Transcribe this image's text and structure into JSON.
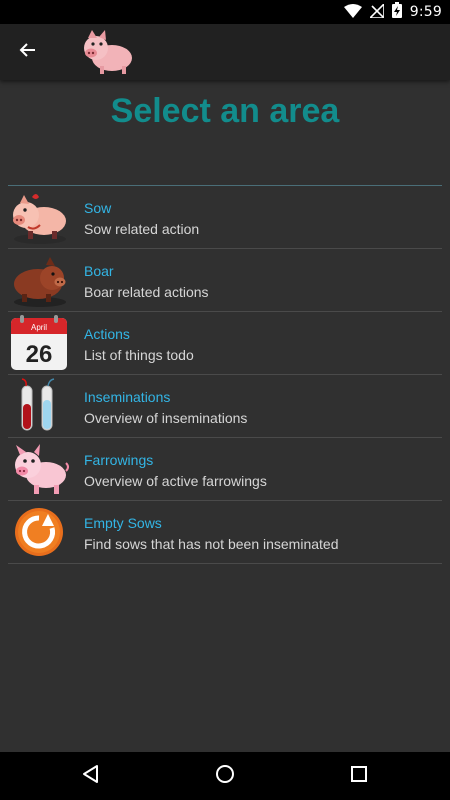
{
  "status_bar": {
    "time": "9:59",
    "icons": [
      "wifi-icon",
      "no-sim-icon",
      "battery-charging-icon"
    ]
  },
  "app_bar": {
    "back_icon": "arrow-left-icon",
    "logo_icon": "pig-logo-icon"
  },
  "page": {
    "title": "Select an area"
  },
  "areas": [
    {
      "title": "Sow",
      "subtitle": "Sow related action",
      "icon": "sow-pig-icon"
    },
    {
      "title": "Boar",
      "subtitle": "Boar related actions",
      "icon": "boar-pig-icon"
    },
    {
      "title": "Actions",
      "subtitle": "List of things todo",
      "icon": "calendar-icon",
      "calendar": {
        "month": "April",
        "day": "26"
      }
    },
    {
      "title": "Inseminations",
      "subtitle": "Overview of inseminations",
      "icon": "test-tubes-icon"
    },
    {
      "title": "Farrowings",
      "subtitle": "Overview of active farrowings",
      "icon": "piglet-icon"
    },
    {
      "title": "Empty Sows",
      "subtitle": "Find sows that has not been inseminated",
      "icon": "refresh-circle-icon"
    }
  ],
  "nav_bar": {
    "icons": [
      "back-triangle-icon",
      "home-circle-icon",
      "recents-square-icon"
    ]
  },
  "colors": {
    "title_teal": "#128c8c",
    "item_title_blue": "#33b5e5",
    "content_bg": "#303030",
    "app_bar_bg": "#212121"
  }
}
